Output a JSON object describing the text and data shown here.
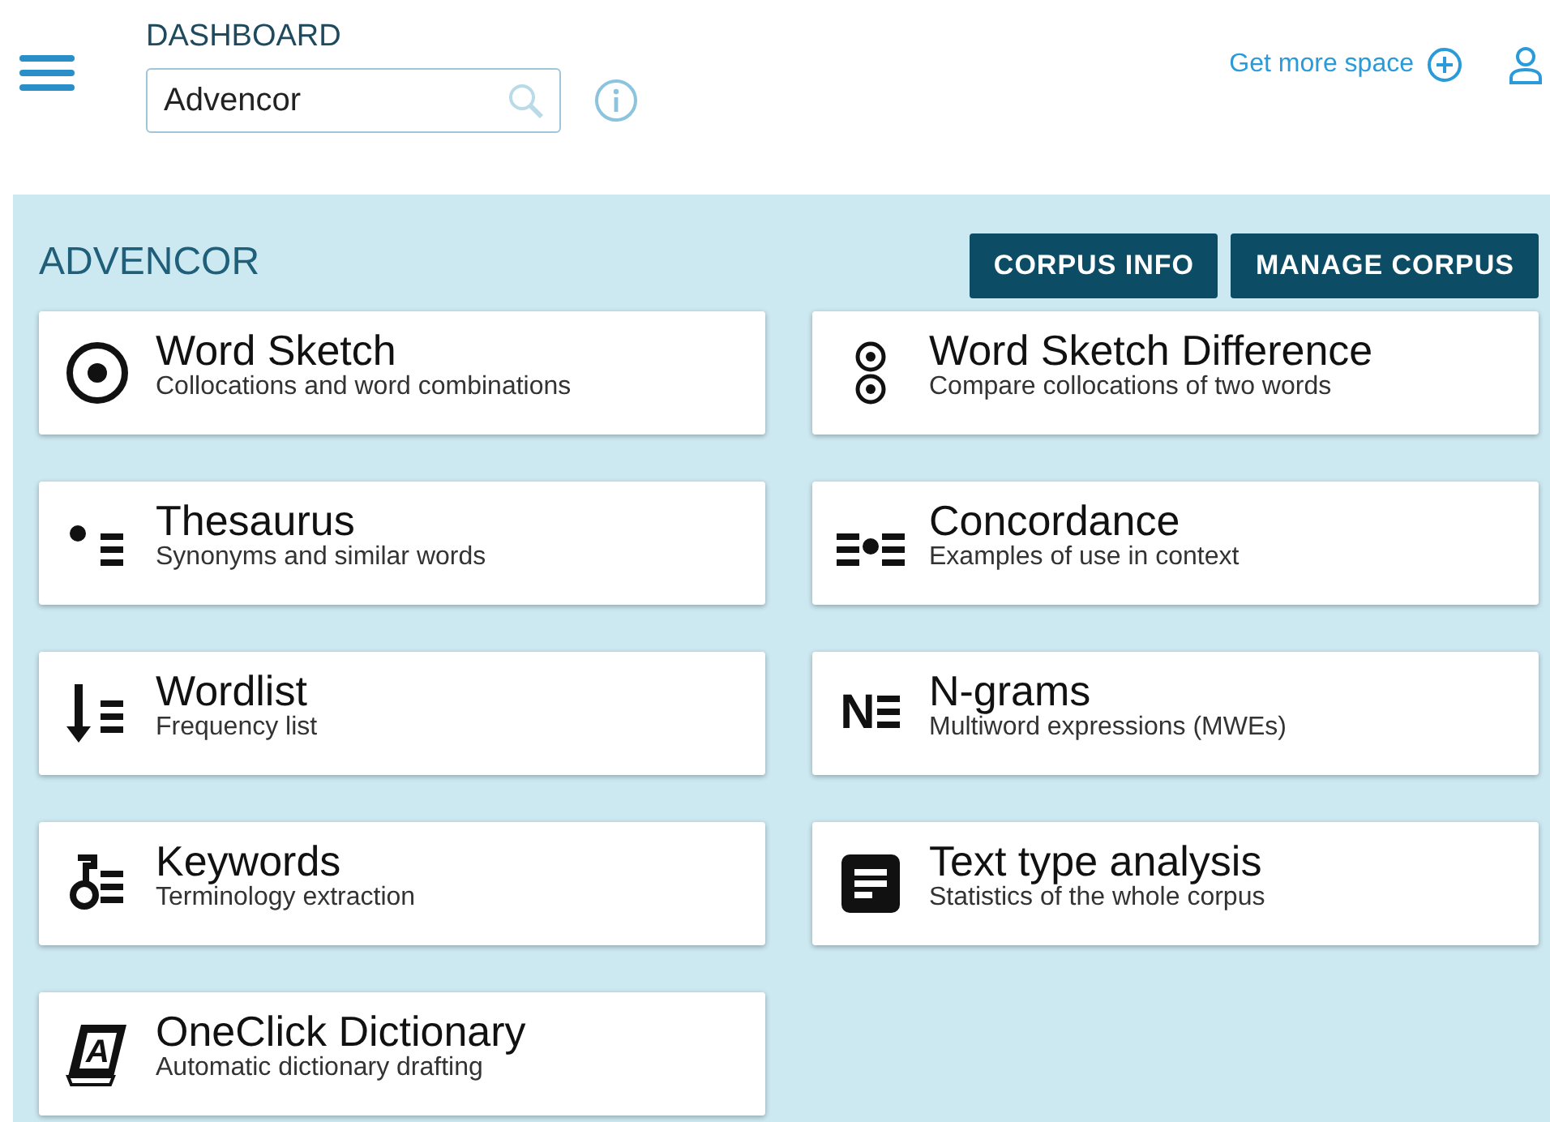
{
  "header": {
    "section": "DASHBOARD",
    "search": {
      "value": "Advencor"
    },
    "link": "Get more space"
  },
  "corpus": {
    "title": "ADVENCOR",
    "buttons": [
      "CORPUS INFO",
      "MANAGE CORPUS"
    ]
  },
  "tools": [
    {
      "kind": "target",
      "title": "Word Sketch",
      "subtitle": "Collocations and word combinations"
    },
    {
      "kind": "double-target",
      "title": "Word Sketch Difference",
      "subtitle": "Compare collocations of two words"
    },
    {
      "kind": "dot-list",
      "title": "Thesaurus",
      "subtitle": "Synonyms and similar words"
    },
    {
      "kind": "concordance",
      "title": "Concordance",
      "subtitle": "Examples of use in context"
    },
    {
      "kind": "arrow-list",
      "title": "Wordlist",
      "subtitle": "Frequency list"
    },
    {
      "kind": "letter-list",
      "glyph": "N",
      "title": "N-grams",
      "subtitle": "Multiword expressions (MWEs)"
    },
    {
      "kind": "key-list",
      "title": "Keywords",
      "subtitle": "Terminology extraction"
    },
    {
      "kind": "document",
      "title": "Text type analysis",
      "subtitle": "Statistics of the whole corpus"
    },
    {
      "kind": "book",
      "glyph": "A",
      "title": "OneClick Dictionary",
      "subtitle": "Automatic dictionary drafting"
    }
  ]
}
